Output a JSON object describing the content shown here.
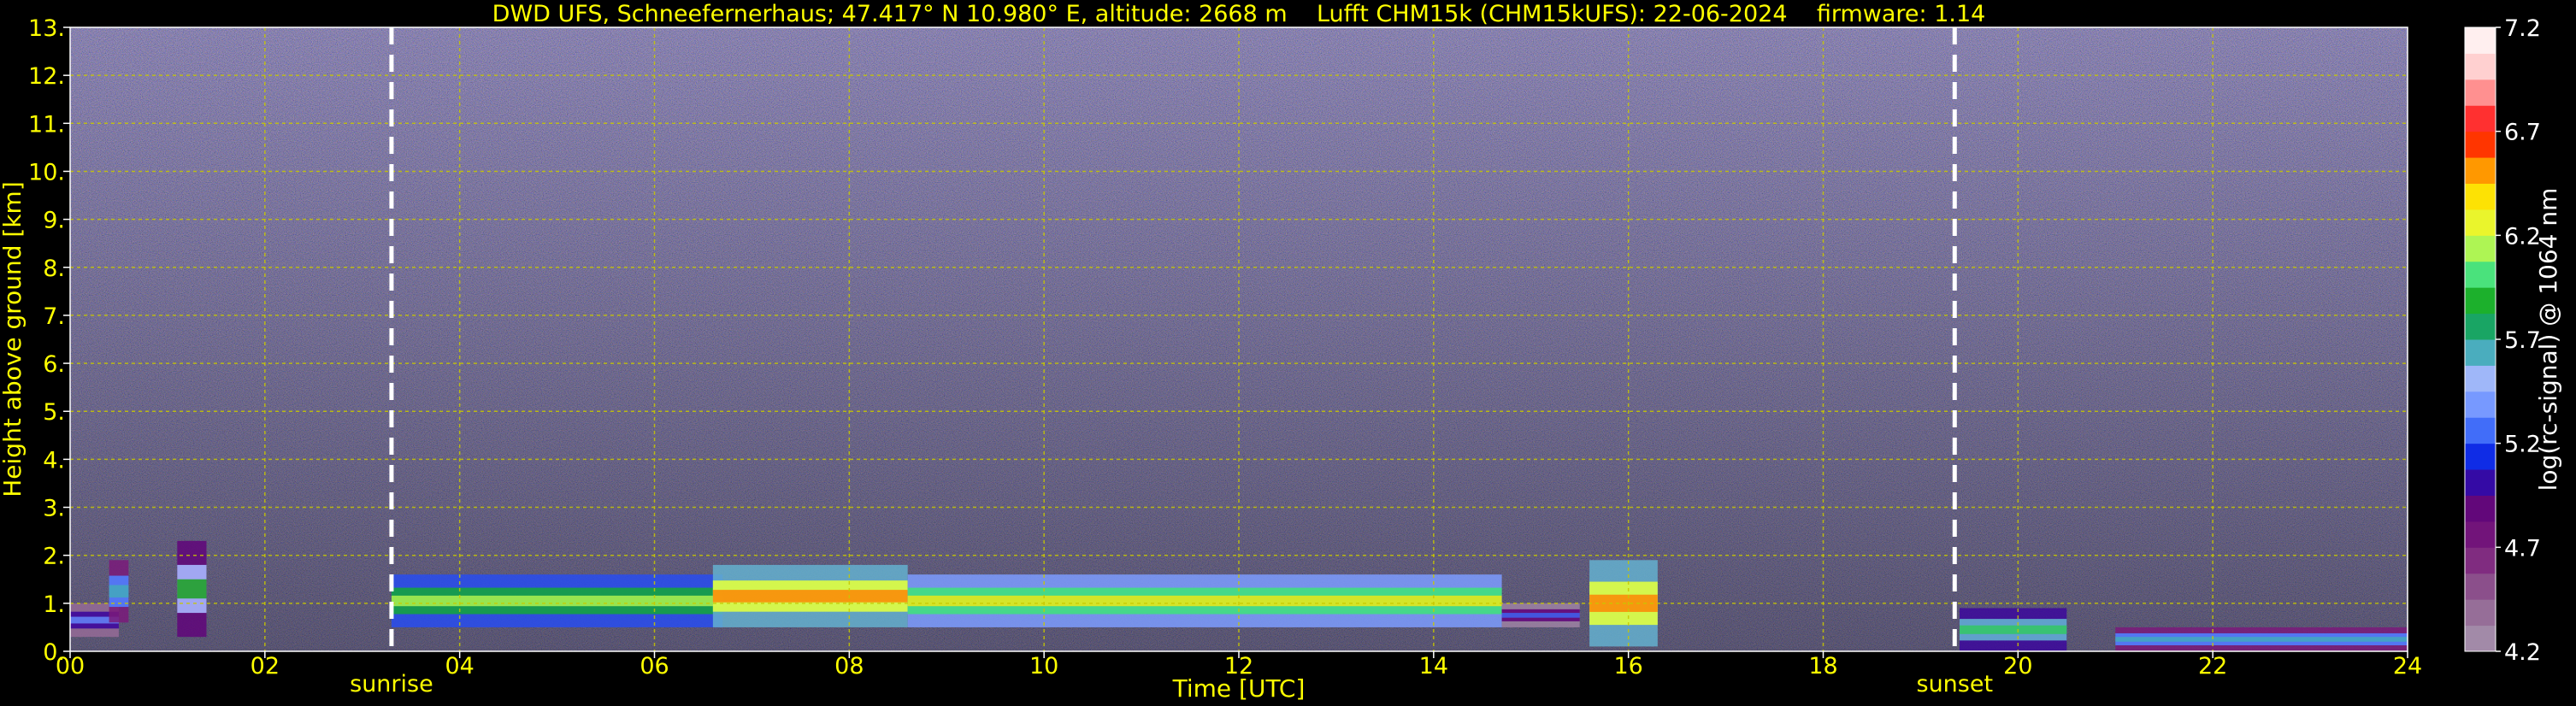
{
  "chart_data": {
    "type": "heatmap",
    "title": "DWD UFS, Schneefernerhaus; 47.417° N 10.980° E, altitude: 2668 m    Lufft CHM15k (CHM15kUFS): 22-06-2024    firmware: 1.14",
    "xlabel": "Time [UTC]",
    "ylabel": "Height above ground [km]",
    "xlim": [
      0,
      24
    ],
    "ylim": [
      0,
      13
    ],
    "x_ticks": [
      0,
      2,
      4,
      6,
      8,
      10,
      12,
      14,
      16,
      18,
      20,
      22,
      24
    ],
    "x_tick_labels": [
      "00",
      "02",
      "04",
      "06",
      "08",
      "10",
      "12",
      "14",
      "16",
      "18",
      "20",
      "22",
      "24"
    ],
    "y_ticks": [
      0,
      1,
      2,
      3,
      4,
      5,
      6,
      7,
      8,
      9,
      10,
      11,
      12,
      13
    ],
    "y_tick_labels": [
      "0.",
      "1.",
      "2.",
      "3.",
      "4.",
      "5.",
      "6.",
      "7.",
      "8.",
      "9.",
      "10.",
      "11.",
      "12.",
      "13."
    ],
    "grid": true,
    "markers": [
      {
        "label": "sunrise",
        "x": 3.3
      },
      {
        "label": "sunset",
        "x": 19.35
      }
    ],
    "colorbar": {
      "label": "log(rc-signal) @ 1064 nm",
      "range": [
        4.2,
        7.2
      ],
      "ticks": [
        4.2,
        4.7,
        5.2,
        5.7,
        6.2,
        6.7,
        7.2
      ],
      "tick_labels": [
        "4.2",
        "4.7",
        "5.2",
        "5.7",
        "6.2",
        "6.7",
        "7.2"
      ]
    },
    "cloud_layers": [
      {
        "x0": 0.0,
        "x1": 0.5,
        "y0": 0.3,
        "y1": 1.0,
        "v": 5.0
      },
      {
        "x0": 0.4,
        "x1": 0.6,
        "y0": 0.6,
        "y1": 1.9,
        "v": 5.3
      },
      {
        "x0": 1.1,
        "x1": 1.4,
        "y0": 0.3,
        "y1": 2.3,
        "v": 5.5
      },
      {
        "x0": 3.3,
        "x1": 6.7,
        "y0": 0.5,
        "y1": 1.6,
        "v": 5.8
      },
      {
        "x0": 6.6,
        "x1": 8.6,
        "y0": 0.5,
        "y1": 1.8,
        "v": 6.2
      },
      {
        "x0": 8.6,
        "x1": 14.7,
        "y0": 0.5,
        "y1": 1.6,
        "v": 6.0
      },
      {
        "x0": 14.7,
        "x1": 15.5,
        "y0": 0.5,
        "y1": 1.0,
        "v": 4.9
      },
      {
        "x0": 15.6,
        "x1": 16.3,
        "y0": 0.1,
        "y1": 1.9,
        "v": 6.2
      },
      {
        "x0": 19.4,
        "x1": 20.5,
        "y0": 0.0,
        "y1": 0.9,
        "v": 5.6
      },
      {
        "x0": 21.0,
        "x1": 24.0,
        "y0": 0.0,
        "y1": 0.5,
        "v": 5.3
      }
    ],
    "colors": {
      "background_noise": "#4a3a7a",
      "axis_text": "#ffff00",
      "grid": "#c8c800",
      "marker_line": "#ffffff"
    }
  }
}
